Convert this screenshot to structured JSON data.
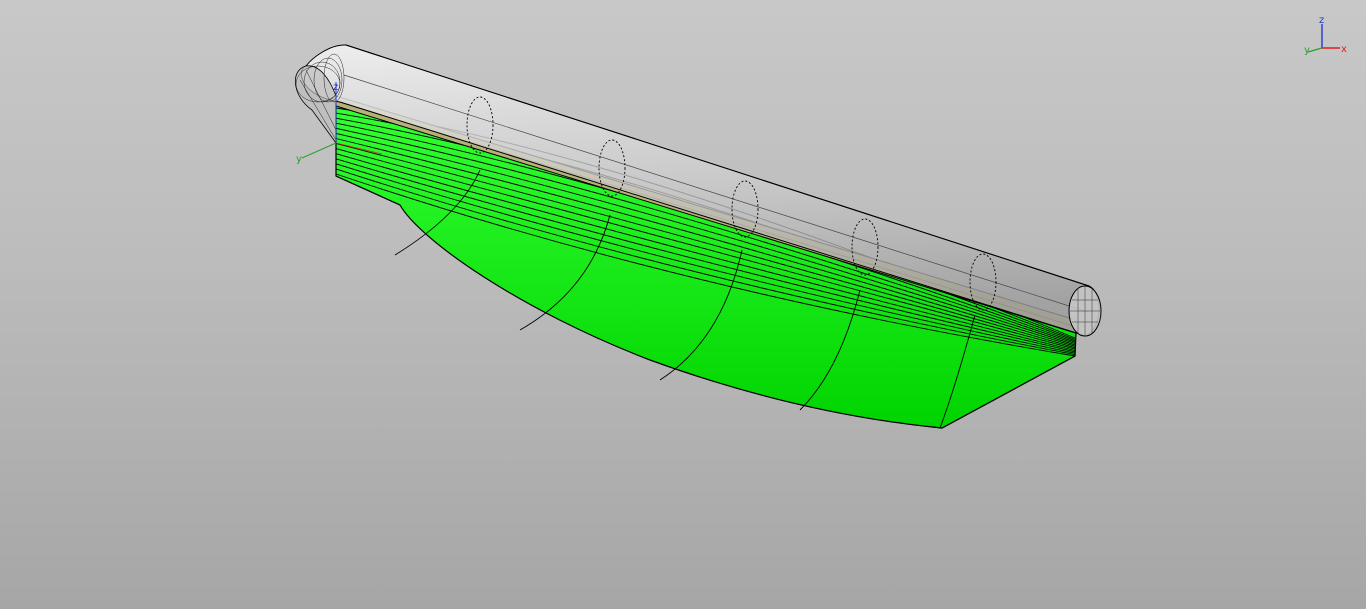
{
  "viewport": {
    "background_top": "#c8c8c8",
    "background_bottom": "#a6a6a6"
  },
  "model": {
    "hull_color": "#00e600",
    "hull_shade_color": "#00c800",
    "deck_band_color": "#b8b07a",
    "tube_color": "#d6d6d6",
    "edge_color": "#000000"
  },
  "triad": {
    "z_label": "z",
    "y_label": "y",
    "x_label": "x",
    "z_color": "#1f3bd6",
    "y_color": "#2aa02a",
    "x_color": "#e01d1d"
  },
  "local_axes": {
    "y_label": "y",
    "z_label": "z"
  }
}
